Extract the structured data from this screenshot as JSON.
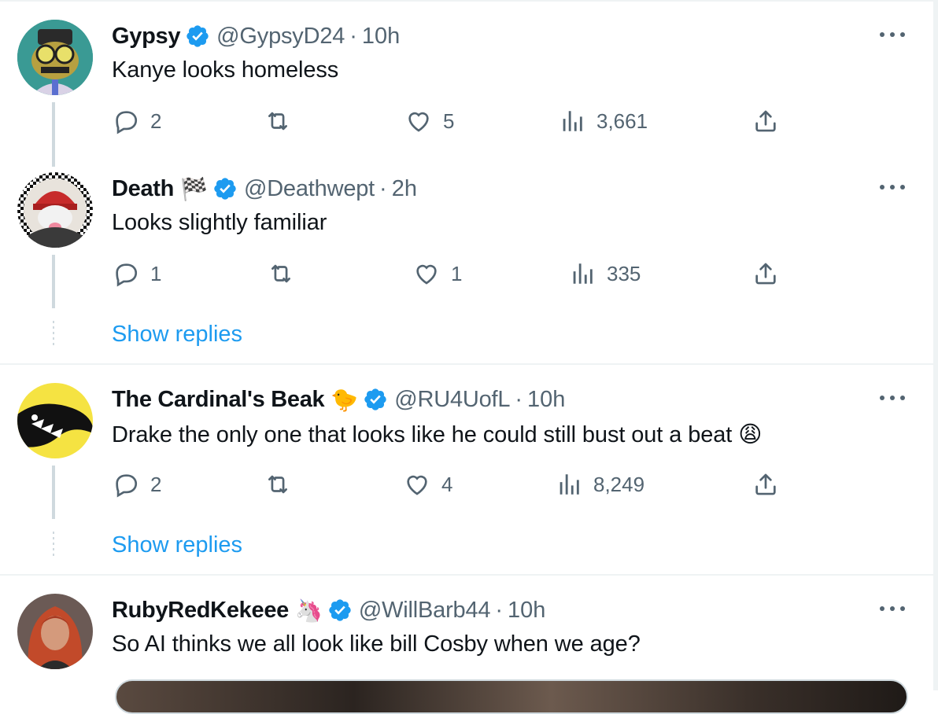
{
  "replies": [
    {
      "display_name": "Gypsy",
      "handle": "@GypsyD24",
      "separator": "·",
      "time": "10h",
      "text": "Kanye looks homeless",
      "reply_count": "2",
      "retweet_count": "",
      "like_count": "5",
      "view_count": "3,661",
      "verified": true,
      "avatar": "cartoon-character-avatar"
    },
    {
      "display_name": "Death",
      "name_emoji": "🏁",
      "handle": "@Deathwept",
      "separator": "·",
      "time": "2h",
      "text": "Looks slightly familiar",
      "reply_count": "1",
      "retweet_count": "",
      "like_count": "1",
      "view_count": "335",
      "verified": true,
      "avatar": "red-beanie-character-avatar",
      "show_replies": "Show replies"
    },
    {
      "display_name": "The Cardinal's Beak",
      "name_emoji": "🐤",
      "handle": "@RU4UofL",
      "separator": "·",
      "time": "10h",
      "text": "Drake the only one that looks like he could still bust out a beat",
      "text_emoji": "😩",
      "reply_count": "2",
      "retweet_count": "",
      "like_count": "4",
      "view_count": "8,249",
      "verified": true,
      "avatar": "cardinal-logo-avatar",
      "show_replies": "Show replies"
    },
    {
      "display_name": "RubyRedKekeee",
      "name_emoji": "🦄",
      "handle": "@WillBarb44",
      "separator": "·",
      "time": "10h",
      "text": "So AI thinks we all look like bill Cosby when we age?",
      "verified": true,
      "avatar": "photo-avatar"
    }
  ],
  "colors": {
    "accent": "#1d9bf0",
    "secondary_text": "#536471",
    "primary_text": "#0f1419",
    "divider": "#eff3f4"
  },
  "icons": [
    "reply-icon",
    "retweet-icon",
    "like-icon",
    "views-icon",
    "share-icon",
    "more-icon",
    "verified-badge-icon"
  ]
}
